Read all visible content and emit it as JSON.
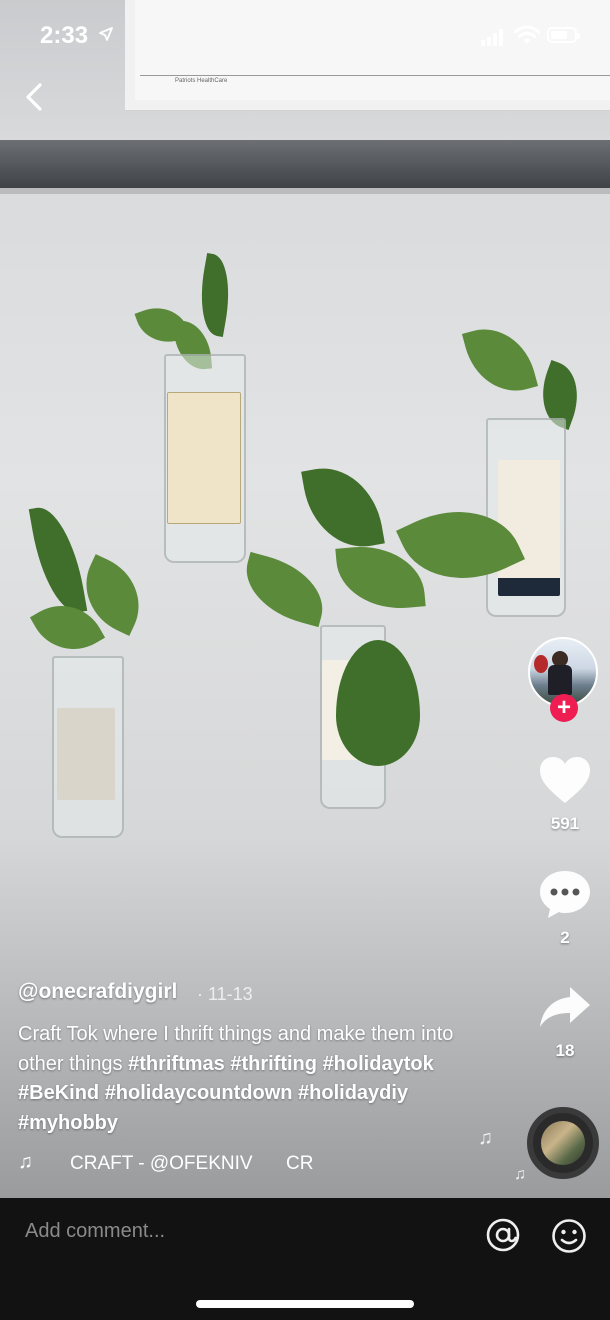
{
  "status_bar": {
    "time": "2:33",
    "location_icon": "location-arrow-icon",
    "signal_icon": "signal-icon",
    "wifi_icon": "wifi-icon",
    "battery_icon": "battery-icon"
  },
  "video": {
    "paper_text": "Patriots HealthCare"
  },
  "rail": {
    "like_count": "591",
    "comment_count": "2",
    "share_count": "18",
    "follow_label": "+"
  },
  "post": {
    "username": "@onecrafdiygirl",
    "date": "· 11-13",
    "caption_text": "Craft Tok where I thrift things and make them into other things",
    "hashtags": [
      "#thriftmas",
      "#thrifting",
      "#holidaytok",
      "#BeKind",
      "#holidaycountdown",
      "#holidaydiy",
      "#myhobby"
    ],
    "music_text": "CRAFT - @OFEKNIV",
    "music_text_repeat": "CR"
  },
  "comment_bar": {
    "placeholder": "Add comment..."
  },
  "colors": {
    "follow_red": "#ee1d52",
    "comment_bar_bg": "#121212"
  }
}
